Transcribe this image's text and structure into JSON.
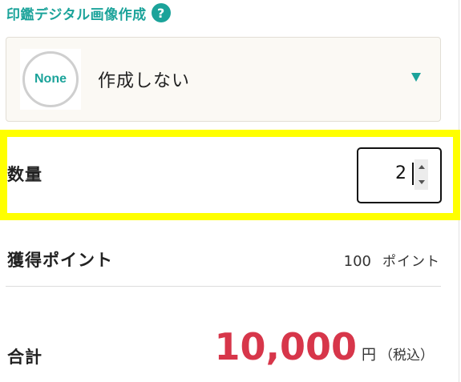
{
  "section": {
    "title": "印鑑デジタル画像作成",
    "help_glyph": "?"
  },
  "select": {
    "thumb_text": "None",
    "selected_label": "作成しない",
    "caret_icon": "triangle-down-icon"
  },
  "quantity": {
    "label": "数量",
    "value": "2"
  },
  "points": {
    "label": "獲得ポイント",
    "value": "100",
    "unit": "ポイント"
  },
  "total": {
    "label": "合計",
    "amount": "10,000",
    "currency": "円",
    "tax_note": "（税込）"
  },
  "colors": {
    "accent": "#1ba39a",
    "price": "#d7364a",
    "highlight": "#ffff00"
  }
}
